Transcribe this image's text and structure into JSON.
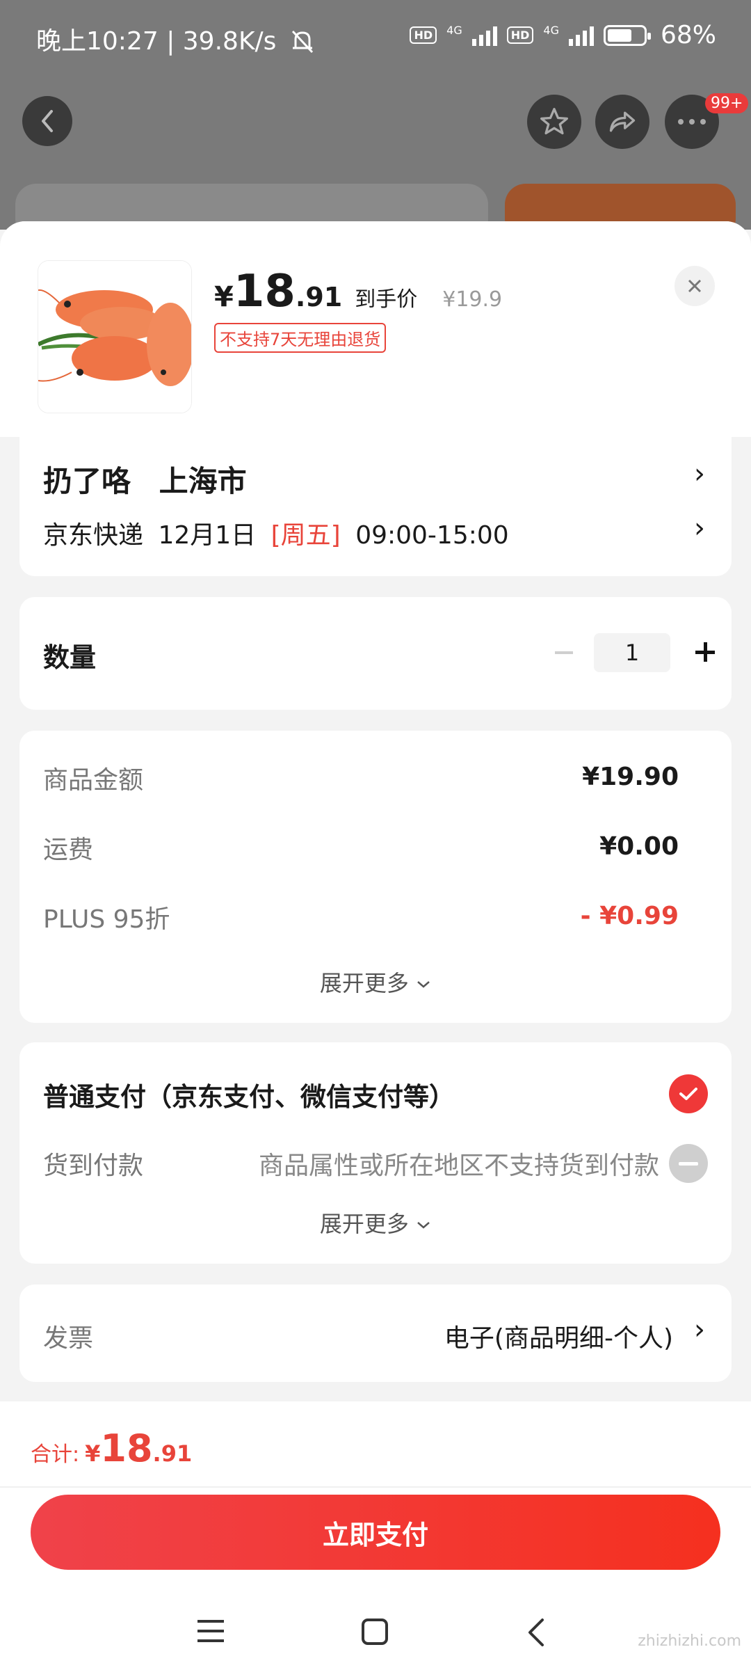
{
  "status_bar": {
    "time": "晚上10:27",
    "speed": "39.8K/s",
    "network_label": "4G",
    "hd_label": "HD",
    "battery": "68%"
  },
  "top_nav": {
    "more_badge": "99+"
  },
  "product": {
    "currency": "¥",
    "price_integer": "18",
    "price_decimal": ".91",
    "price_note": "到手价",
    "original_price": "¥19.9",
    "return_tag": "不支持7天无理由退货"
  },
  "address": {
    "recipient": "扔了咯",
    "city": "上海市",
    "delivery_carrier": "京东快递",
    "delivery_date": "12月1日",
    "delivery_weekday": "[周五]",
    "delivery_time": "09:00-15:00"
  },
  "quantity": {
    "label": "数量",
    "value": "1"
  },
  "fees": {
    "items": [
      {
        "label": "商品金额",
        "value": "¥19.90"
      },
      {
        "label": "运费",
        "value": "¥0.00"
      },
      {
        "label": "PLUS 95折",
        "value": "- ¥0.99"
      }
    ],
    "expand": "展开更多"
  },
  "payment": {
    "normal_label": "普通支付（京东支付、微信支付等）",
    "cod_label": "货到付款",
    "cod_note": "商品属性或所在地区不支持货到付款",
    "expand": "展开更多"
  },
  "invoice": {
    "label": "发票",
    "value": "电子(商品明细-个人)"
  },
  "bottom": {
    "total_label": "合计:",
    "total_currency": "¥",
    "total_integer": "18",
    "total_decimal": ".91",
    "pay_button": "立即支付"
  },
  "watermark": "zhizhizhi.com",
  "colors": {
    "accent_red": "#e8443a",
    "button_start": "#f0424a",
    "button_end": "#f5301f"
  }
}
